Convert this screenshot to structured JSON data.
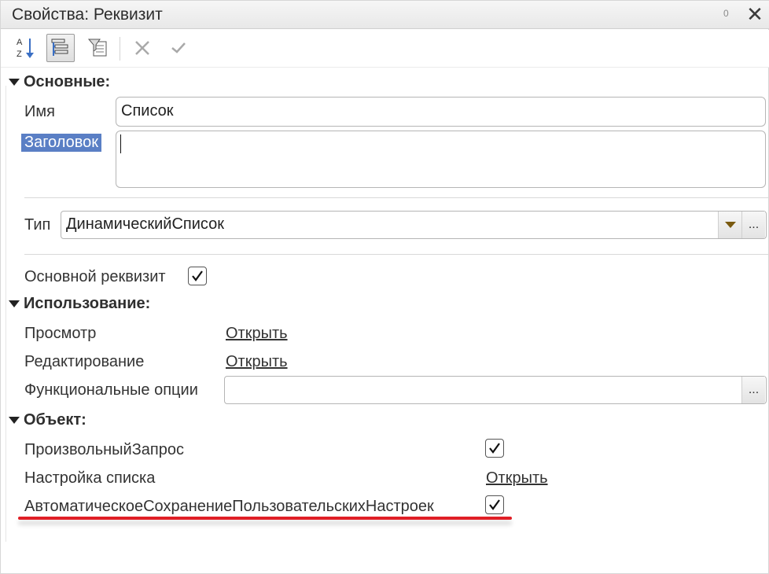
{
  "window": {
    "title": "Свойства: Реквизит",
    "pin_glyph": "0",
    "close_glyph": "✕"
  },
  "toolbar": {
    "sort_icon_text": "AZ",
    "buttons": [
      "sort-az",
      "categories",
      "filter",
      "cancel",
      "apply"
    ]
  },
  "sections": {
    "main": {
      "title": "Основные:",
      "name_label": "Имя",
      "name_value": "Список",
      "caption_label": "Заголовок",
      "caption_value": "",
      "type_label": "Тип",
      "type_value": "ДинамическийСписок",
      "ellipsis": "...",
      "main_attr_label": "Основной реквизит",
      "main_attr_checked": true
    },
    "usage": {
      "title": "Использование:",
      "view_label": "Просмотр",
      "view_link": "Открыть",
      "edit_label": "Редактирование",
      "edit_link": "Открыть",
      "options_label": "Функциональные опции",
      "options_value": "",
      "ellipsis": "..."
    },
    "object": {
      "title": "Объект:",
      "custom_query_label": "ПроизвольныйЗапрос",
      "custom_query_checked": true,
      "list_settings_label": "Настройка списка",
      "list_settings_link": "Открыть",
      "autosave_label": "АвтоматическоеСохранениеПользовательскихНастроек",
      "autosave_checked": true
    }
  },
  "colors": {
    "selection": "#5a7fc5",
    "highlight_underline": "#e01f26"
  }
}
